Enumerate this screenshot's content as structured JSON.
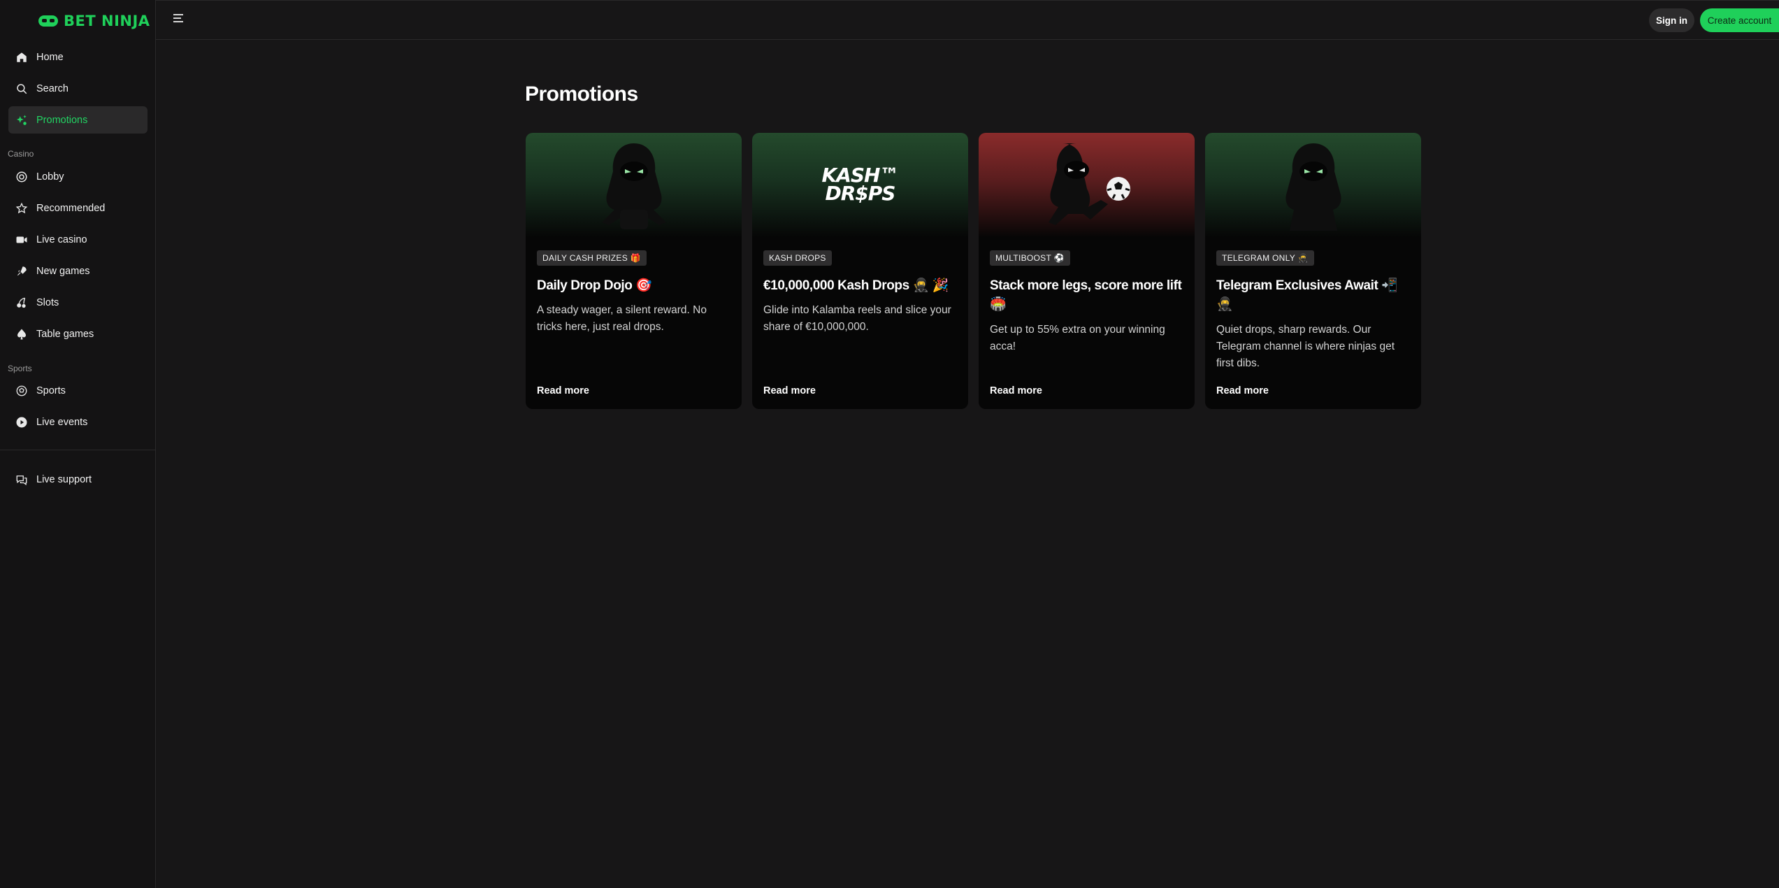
{
  "brand": {
    "name": "BET NINJA",
    "accent": "#1fd05a"
  },
  "sidebar": {
    "main": [
      {
        "label": "Home",
        "icon": "home-icon"
      },
      {
        "label": "Search",
        "icon": "search-icon"
      },
      {
        "label": "Promotions",
        "icon": "sparkle-icon",
        "active": true
      }
    ],
    "casino_label": "Casino",
    "casino": [
      {
        "label": "Lobby",
        "icon": "chip-icon"
      },
      {
        "label": "Recommended",
        "icon": "star-icon"
      },
      {
        "label": "Live casino",
        "icon": "video-icon"
      },
      {
        "label": "New games",
        "icon": "rocket-icon"
      },
      {
        "label": "Slots",
        "icon": "cherries-icon"
      },
      {
        "label": "Table games",
        "icon": "spade-icon"
      }
    ],
    "sports_label": "Sports",
    "sports": [
      {
        "label": "Sports",
        "icon": "ball-icon"
      },
      {
        "label": "Live events",
        "icon": "play-icon"
      }
    ],
    "support": {
      "label": "Live support",
      "icon": "chat-icon"
    }
  },
  "header": {
    "signin_label": "Sign in",
    "create_label": "Create account"
  },
  "main": {
    "title": "Promotions",
    "cards": [
      {
        "badge": "DAILY CASH PRIZES 🎁",
        "title": "Daily Drop Dojo 🎯",
        "desc": "A steady wager, a silent reward. No tricks here, just real drops.",
        "link": "Read more",
        "theme": "green",
        "art": "ninja-icon"
      },
      {
        "badge": "KASH DROPS",
        "title": "€10,000,000 Kash Drops 🥷 🎉",
        "desc": "Glide into Kalamba reels and slice your share of €10,000,000.",
        "link": "Read more",
        "theme": "green",
        "art": "kash-drops-logo",
        "art_text_1": "KASH™",
        "art_text_2": "DR$PS"
      },
      {
        "badge": "MULTIBOOST ⚽",
        "title": "Stack more legs, score more lift 🏟️",
        "desc": "Get up to 55% extra on your winning acca!",
        "link": "Read more",
        "theme": "red",
        "art": "ninja-football-icon"
      },
      {
        "badge": "TELEGRAM ONLY 🥷",
        "title": "Telegram Exclusives Await 📲 🥷",
        "desc": "Quiet drops, sharp rewards. Our Telegram channel is where ninjas get first dibs.",
        "link": "Read more",
        "theme": "green",
        "art": "ninja-icon"
      }
    ]
  }
}
